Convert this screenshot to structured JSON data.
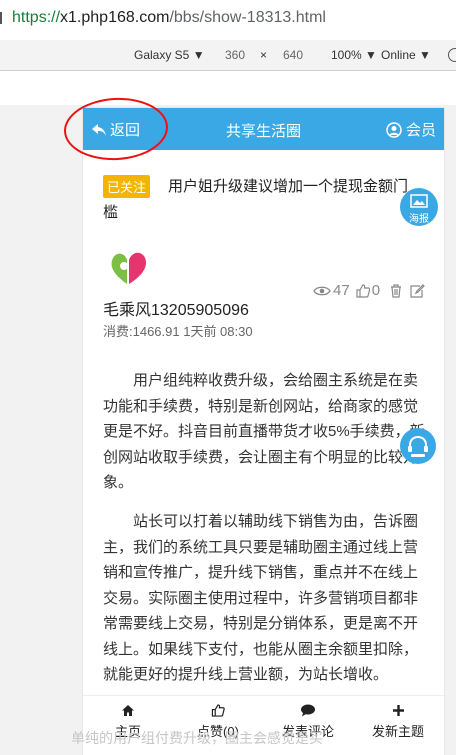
{
  "browser": {
    "url_protocol": "https://",
    "url_host": "x1.php168.com",
    "url_path": "/bbs/show-18313.html",
    "device": "Galaxy S5 ▼",
    "width": "360",
    "times": "×",
    "height": "640",
    "zoom": "100% ▼",
    "network": "Online ▼"
  },
  "topbar": {
    "back_label": "返回",
    "title": "共享生活圈",
    "member_label": "会员"
  },
  "post": {
    "follow_badge": "已关注",
    "title": "用户姐升级建议增加一个提现金额门槛",
    "poster_label": "海报",
    "author": "毛乘风13205905096",
    "meta": "消费:1466.91 1天前 08:30",
    "views": "47",
    "likes": "0",
    "paragraphs": [
      "用户组纯粹收费升级，会给圈主系统是在卖功能和手续费，特别是新创网站，给商家的感觉更是不好。抖音目前直播带货才收5%手续费，新创网站收取手续费，会让圈主有个明显的比较对象。",
      "站长可以打着以辅助线下销售为由，告诉圈主，我们的系统工具只要是辅助圈主通过线上营销和宣传推广，提升线下销售，重点并不在线上交易。实际圈主使用过程中，许多营销项目都非常需要线上交易，特别是分销体系，更是离不开线上。如果线下支付，也能从圈主余额里扣除，就能更好的提升线上营业额，为站长增收。"
    ],
    "ghost_text": "单纯的用户组付费升级，圈主会感觉是买"
  },
  "bottom_nav": {
    "home": "主页",
    "like": "点赞(0)",
    "comment": "发表评论",
    "new_topic": "发新主题"
  },
  "colors": {
    "accent": "#3aa8e4",
    "badge": "#f5b400",
    "annotation": "#e11111"
  }
}
